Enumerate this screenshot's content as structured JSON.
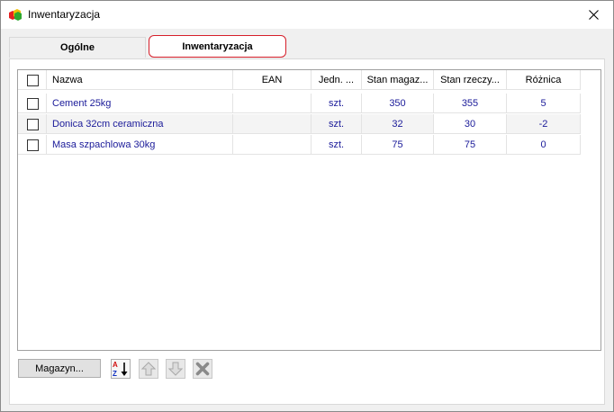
{
  "window": {
    "title": "Inwentaryzacja",
    "close_icon": "close-icon",
    "app_icon": "cubes-icon"
  },
  "tabs": [
    {
      "label": "Ogólne",
      "active": false
    },
    {
      "label": "Inwentaryzacja",
      "active": true
    }
  ],
  "table": {
    "columns": [
      "Nazwa",
      "EAN",
      "Jedn. ...",
      "Stan magaz...",
      "Stan rzeczy...",
      "Różnica"
    ],
    "rows": [
      {
        "checked": false,
        "name": "Cement 25kg",
        "ean": "",
        "unit": "szt.",
        "stock": "350",
        "real": "355",
        "diff": "5"
      },
      {
        "checked": false,
        "name": "Donica 32cm ceramiczna",
        "ean": "",
        "unit": "szt.",
        "stock": "32",
        "real": "30",
        "diff": "-2"
      },
      {
        "checked": false,
        "name": "Masa szpachlowa 30kg",
        "ean": "",
        "unit": "szt.",
        "stock": "75",
        "real": "75",
        "diff": "0"
      }
    ]
  },
  "toolbar": {
    "magazyn_label": "Magazyn...",
    "sort_icon": "sort-az-icon",
    "up_icon": "arrow-up-icon",
    "down_icon": "arrow-down-icon",
    "delete_icon": "delete-x-icon"
  },
  "colors": {
    "active_tab_border": "#d61f2a",
    "data_text": "#1a1a99"
  }
}
